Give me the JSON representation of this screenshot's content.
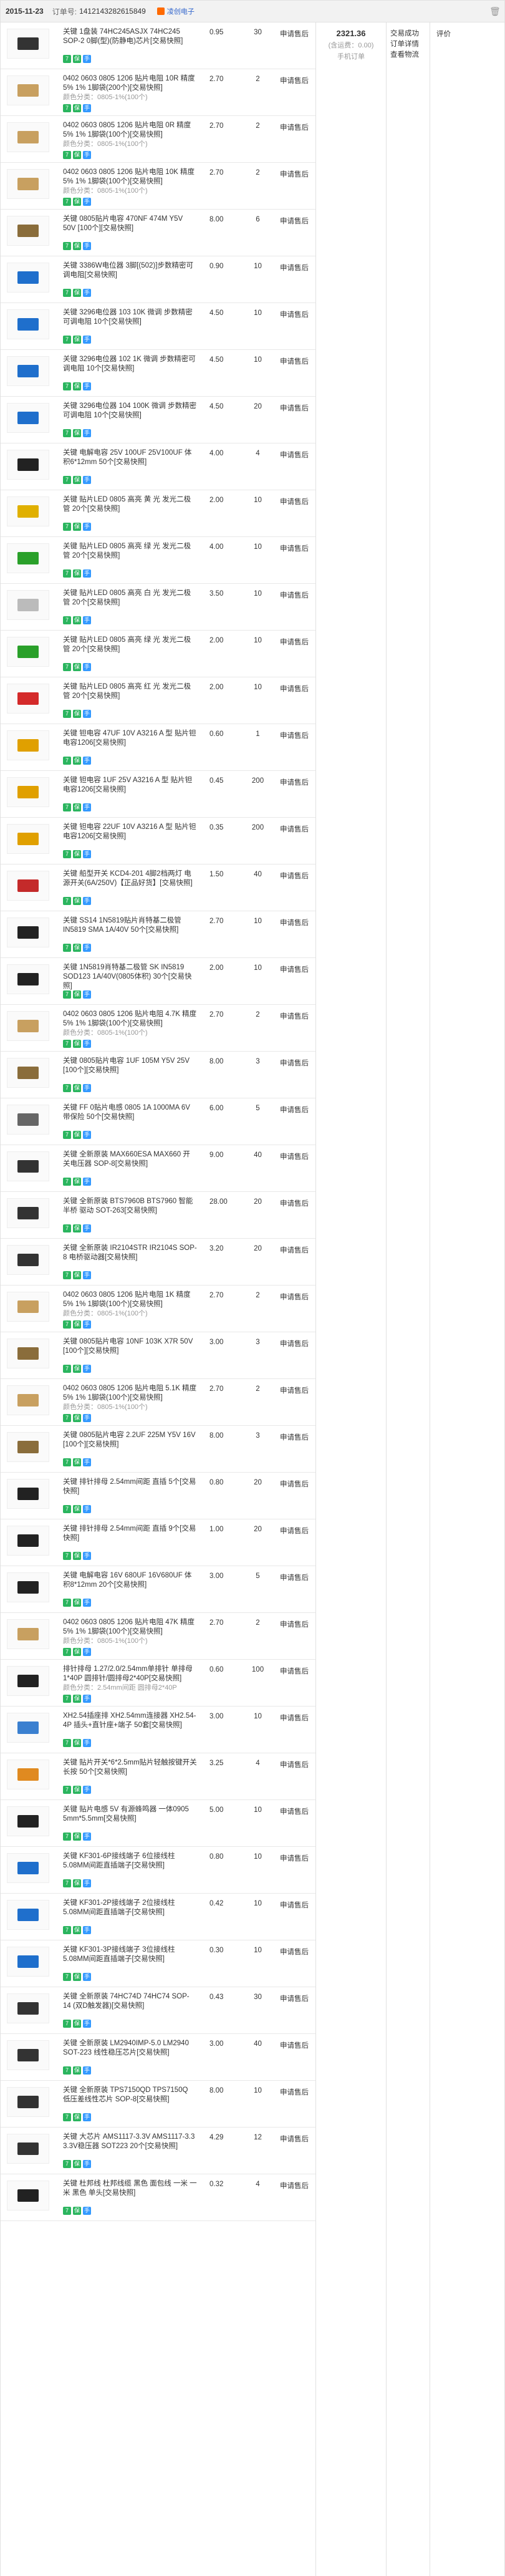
{
  "order": {
    "date": "2015-11-23",
    "order_no_label": "订单号:",
    "order_no": "1412143282615849",
    "shop_name": "凌创电子",
    "delete_icon": "trash-icon"
  },
  "summary": {
    "total": "2321.36",
    "shipping": "(含运费：0.00)",
    "payment": "手机订单"
  },
  "status": {
    "lines": [
      "交易成功",
      "订单详情",
      "查看物流"
    ]
  },
  "actions": {
    "evaluate": "评价"
  },
  "badge_icons": [
    "seven-day-return-icon",
    "guarantee-icon",
    "mobile-order-icon"
  ],
  "badge_glyphs": [
    "7",
    "保",
    "手"
  ],
  "items": [
    {
      "title": "关键 1盘装 74HC245ASJX 74HC245 SOP-2 0脚(型)(防静电)芯片[交易快照]",
      "sub": "",
      "price": "0.95",
      "qty": "30",
      "refund": "申请售后",
      "icon": "ic-chip-icon",
      "color": "#333333"
    },
    {
      "title": "0402 0603 0805 1206 贴片电阻 10R 精度5% 1% 1脚袋(200个)[交易快照]",
      "sub": "颜色分类：0805-1%(100个)",
      "price": "2.70",
      "qty": "2",
      "refund": "申请售后",
      "icon": "resistor-strip-icon",
      "color": "#c8a060"
    },
    {
      "title": "0402 0603 0805 1206 贴片电阻 0R 精度5% 1% 1脚袋(100个)[交易快照]",
      "sub": "颜色分类：0805-1%(100个)",
      "price": "2.70",
      "qty": "2",
      "refund": "申请售后",
      "icon": "resistor-strip-icon",
      "color": "#c8a060"
    },
    {
      "title": "0402 0603 0805 1206 贴片电阻 10K 精度5% 1% 1脚袋(100个)[交易快照]",
      "sub": "颜色分类：0805-1%(100个)",
      "price": "2.70",
      "qty": "2",
      "refund": "申请售后",
      "icon": "resistor-strip-icon",
      "color": "#c8a060"
    },
    {
      "title": "关键 0805贴片电容 470NF 474M Y5V 50V [100个][交易快照]",
      "sub": "",
      "price": "8.00",
      "qty": "6",
      "refund": "申请售后",
      "icon": "capacitor-icon",
      "color": "#8a6d3b"
    },
    {
      "title": "关键 3386W电位器 3脚[(502)]步数精密可调电阻[交易快照]",
      "sub": "",
      "price": "0.90",
      "qty": "10",
      "refund": "申请售后",
      "icon": "potentiometer-icon",
      "color": "#1f6fcc"
    },
    {
      "title": "关键 3296电位器 103 10K 微调 步数精密可调电阻 10个[交易快照]",
      "sub": "",
      "price": "4.50",
      "qty": "10",
      "refund": "申请售后",
      "icon": "potentiometer-icon",
      "color": "#1f6fcc"
    },
    {
      "title": "关键 3296电位器 102 1K 微调 步数精密可调电阻 10个[交易快照]",
      "sub": "",
      "price": "4.50",
      "qty": "10",
      "refund": "申请售后",
      "icon": "potentiometer-icon",
      "color": "#1f6fcc"
    },
    {
      "title": "关键 3296电位器 104 100K 微调 步数精密可调电阻 10个[交易快照]",
      "sub": "",
      "price": "4.50",
      "qty": "20",
      "refund": "申请售后",
      "icon": "potentiometer-icon",
      "color": "#1f6fcc"
    },
    {
      "title": "关键 电解电容 25V 100UF 25V100UF 体积6*12mm 50个[交易快照]",
      "sub": "",
      "price": "4.00",
      "qty": "4",
      "refund": "申请售后",
      "icon": "electrolytic-capacitor-icon",
      "color": "#222222"
    },
    {
      "title": "关键 贴片LED 0805 高亮 黄 光 发光二极管 20个[交易快照]",
      "sub": "",
      "price": "2.00",
      "qty": "10",
      "refund": "申请售后",
      "icon": "led-icon",
      "color": "#e0b000"
    },
    {
      "title": "关键 贴片LED 0805 高亮 绿 光 发光二极管 20个[交易快照]",
      "sub": "",
      "price": "4.00",
      "qty": "10",
      "refund": "申请售后",
      "icon": "led-icon",
      "color": "#2aa02a"
    },
    {
      "title": "关键 贴片LED 0805 高亮 白 光 发光二极管 20个[交易快照]",
      "sub": "",
      "price": "3.50",
      "qty": "10",
      "refund": "申请售后",
      "icon": "led-icon",
      "color": "#bbbbbb"
    },
    {
      "title": "关键 贴片LED 0805 高亮 绿 光 发光二极管 20个[交易快照]",
      "sub": "",
      "price": "2.00",
      "qty": "10",
      "refund": "申请售后",
      "icon": "led-icon",
      "color": "#2aa02a"
    },
    {
      "title": "关键 贴片LED 0805 高亮 红 光 发光二极管 20个[交易快照]",
      "sub": "",
      "price": "2.00",
      "qty": "10",
      "refund": "申请售后",
      "icon": "led-icon",
      "color": "#d42a2a"
    },
    {
      "title": "关键 钽电容 47UF 10V A3216 A 型 贴片钽电容1206[交易快照]",
      "sub": "",
      "price": "0.60",
      "qty": "1",
      "refund": "申请售后",
      "icon": "tantalum-capacitor-icon",
      "color": "#e0a000"
    },
    {
      "title": "关键 钽电容 1UF 25V A3216 A 型 贴片钽电容1206[交易快照]",
      "sub": "",
      "price": "0.45",
      "qty": "200",
      "refund": "申请售后",
      "icon": "tantalum-capacitor-icon",
      "color": "#e0a000"
    },
    {
      "title": "关键 钽电容 22UF 10V A3216 A 型 贴片钽电容1206[交易快照]",
      "sub": "",
      "price": "0.35",
      "qty": "200",
      "refund": "申请售后",
      "icon": "tantalum-capacitor-icon",
      "color": "#e0a000"
    },
    {
      "title": "关键 船型开关 KCD4-201 4脚2档两灯 电源开关(6A/250V)【正品好货】[交易快照]",
      "sub": "",
      "price": "1.50",
      "qty": "40",
      "refund": "申请售后",
      "icon": "rocker-switch-icon",
      "color": "#c42a2a"
    },
    {
      "title": "关键 SS14 1N5819贴片肖特基二极管 IN5819 SMA 1A/40V 50个[交易快照]",
      "sub": "",
      "price": "2.70",
      "qty": "10",
      "refund": "申请售后",
      "icon": "diode-icon",
      "color": "#222222"
    },
    {
      "title": "关键 1N5819肖特基二极管 SK IN5819 SOD123 1A/40V(0805体积) 30个[交易快照]",
      "sub": "",
      "price": "2.00",
      "qty": "10",
      "refund": "申请售后",
      "icon": "diode-icon",
      "color": "#222222"
    },
    {
      "title": "0402 0603 0805 1206 贴片电阻 4.7K 精度5% 1% 1脚袋(100个)[交易快照]",
      "sub": "颜色分类：0805-1%(100个)",
      "price": "2.70",
      "qty": "2",
      "refund": "申请售后",
      "icon": "resistor-strip-icon",
      "color": "#c8a060"
    },
    {
      "title": "关键 0805贴片电容 1UF 105M Y5V 25V [100个][交易快照]",
      "sub": "",
      "price": "8.00",
      "qty": "3",
      "refund": "申请售后",
      "icon": "capacitor-icon",
      "color": "#8a6d3b"
    },
    {
      "title": "关键 FF 0贴片电感 0805 1A 1000MA 6V 带保险 50个[交易快照]",
      "sub": "",
      "price": "6.00",
      "qty": "5",
      "refund": "申请售后",
      "icon": "fuse-icon",
      "color": "#666666"
    },
    {
      "title": "关键 全新原装 MAX660ESA MAX660 开关电压器 SOP-8[交易快照]",
      "sub": "",
      "price": "9.00",
      "qty": "40",
      "refund": "申请售后",
      "icon": "ic-chip-icon",
      "color": "#333333"
    },
    {
      "title": "关键 全新原装 BTS7960B BTS7960 智能半桥 驱动 SOT-263[交易快照]",
      "sub": "",
      "price": "28.00",
      "qty": "20",
      "refund": "申请售后",
      "icon": "ic-chip-icon",
      "color": "#333333"
    },
    {
      "title": "关键 全新原装 IR2104STR IR2104S SOP-8 电桥驱动器[交易快照]",
      "sub": "",
      "price": "3.20",
      "qty": "20",
      "refund": "申请售后",
      "icon": "ic-chip-icon",
      "color": "#333333"
    },
    {
      "title": "0402 0603 0805 1206 贴片电阻 1K 精度5% 1% 1脚袋(100个)[交易快照]",
      "sub": "颜色分类：0805-1%(100个)",
      "price": "2.70",
      "qty": "2",
      "refund": "申请售后",
      "icon": "resistor-strip-icon",
      "color": "#c8a060"
    },
    {
      "title": "关键 0805贴片电容 10NF 103K X7R 50V [100个][交易快照]",
      "sub": "",
      "price": "3.00",
      "qty": "3",
      "refund": "申请售后",
      "icon": "capacitor-icon",
      "color": "#8a6d3b"
    },
    {
      "title": "0402 0603 0805 1206 贴片电阻 5.1K 精度5% 1% 1脚袋(100个)[交易快照]",
      "sub": "颜色分类：0805-1%(100个)",
      "price": "2.70",
      "qty": "2",
      "refund": "申请售后",
      "icon": "resistor-strip-icon",
      "color": "#c8a060"
    },
    {
      "title": "关键 0805贴片电容 2.2UF 225M Y5V 16V [100个][交易快照]",
      "sub": "",
      "price": "8.00",
      "qty": "3",
      "refund": "申请售后",
      "icon": "capacitor-icon",
      "color": "#8a6d3b"
    },
    {
      "title": "关键 排针排母 2.54mm间距 直插 5个[交易快照]",
      "sub": "",
      "price": "0.80",
      "qty": "20",
      "refund": "申请售后",
      "icon": "pin-header-icon",
      "color": "#222222"
    },
    {
      "title": "关键 排针排母 2.54mm间距 直插 9个[交易快照]",
      "sub": "",
      "price": "1.00",
      "qty": "20",
      "refund": "申请售后",
      "icon": "pin-header-icon",
      "color": "#222222"
    },
    {
      "title": "关键 电解电容 16V 680UF 16V680UF 体积8*12mm 20个[交易快照]",
      "sub": "",
      "price": "3.00",
      "qty": "5",
      "refund": "申请售后",
      "icon": "electrolytic-capacitor-icon",
      "color": "#222222"
    },
    {
      "title": "0402 0603 0805 1206 贴片电阻 47K 精度5% 1% 1脚袋(100个)[交易快照]",
      "sub": "颜色分类：0805-1%(100个)",
      "price": "2.70",
      "qty": "2",
      "refund": "申请售后",
      "icon": "resistor-strip-icon",
      "color": "#c8a060"
    },
    {
      "title": "排针排母 1.27/2.0/2.54mm单排针 单排母1*40P 圆排针/圆排母2*40P[交易快照]",
      "sub": "颜色分类：2.54mm间距 圆排母2*40P",
      "price": "0.60",
      "qty": "100",
      "refund": "申请售后",
      "icon": "pin-header-icon",
      "color": "#222222"
    },
    {
      "title": "XH2.54插座排 XH2.54mm连接器 XH2.54-4P 插头+直针座+端子 50套[交易快照]",
      "sub": "",
      "price": "3.00",
      "qty": "10",
      "refund": "申请售后",
      "icon": "connector-icon",
      "color": "#3a80d0"
    },
    {
      "title": "关键 贴片开关*6*2.5mm贴片轻触按键开关 长按 50个[交易快照]",
      "sub": "",
      "price": "3.25",
      "qty": "4",
      "refund": "申请售后",
      "icon": "tactile-switch-icon",
      "color": "#e08a20"
    },
    {
      "title": "关键 贴片电感 5V 有源蜂鸣器 一体0905 5mm*5.5mm[交易快照]",
      "sub": "",
      "price": "5.00",
      "qty": "10",
      "refund": "申请售后",
      "icon": "buzzer-icon",
      "color": "#222222"
    },
    {
      "title": "关键 KF301-6P接线端子 6位接线柱 5.08MM间距直插端子[交易快照]",
      "sub": "",
      "price": "0.80",
      "qty": "10",
      "refund": "申请售后",
      "icon": "terminal-block-icon",
      "color": "#1f6fcc"
    },
    {
      "title": "关键 KF301-2P接线端子 2位接线柱 5.08MM间距直插端子[交易快照]",
      "sub": "",
      "price": "0.42",
      "qty": "10",
      "refund": "申请售后",
      "icon": "terminal-block-icon",
      "color": "#1f6fcc"
    },
    {
      "title": "关键 KF301-3P接线端子 3位接线柱 5.08MM间距直插端子[交易快照]",
      "sub": "",
      "price": "0.30",
      "qty": "10",
      "refund": "申请售后",
      "icon": "terminal-block-icon",
      "color": "#1f6fcc"
    },
    {
      "title": "关键 全新原装 74HC74D 74HC74 SOP-14 (双D触发器)[交易快照]",
      "sub": "",
      "price": "0.43",
      "qty": "30",
      "refund": "申请售后",
      "icon": "ic-chip-icon",
      "color": "#333333"
    },
    {
      "title": "关键 全新原装 LM2940IMP-5.0 LM2940 SOT-223 线性稳压芯片[交易快照]",
      "sub": "",
      "price": "3.00",
      "qty": "40",
      "refund": "申请售后",
      "icon": "ic-chip-icon",
      "color": "#333333"
    },
    {
      "title": "关键 全新原装 TPS7150QD TPS7150Q 低压差线性芯片 SOP-8[交易快照]",
      "sub": "",
      "price": "8.00",
      "qty": "10",
      "refund": "申请售后",
      "icon": "ic-chip-icon",
      "color": "#333333"
    },
    {
      "title": "关键 大芯片 AMS1117-3.3V AMS1117-3.3 3.3V稳压器 SOT223 20个[交易快照]",
      "sub": "",
      "price": "4.29",
      "qty": "12",
      "refund": "申请售后",
      "icon": "ic-chip-icon",
      "color": "#333333"
    },
    {
      "title": "关键 杜邦线 杜邦线缆 黑色 面包线 一米 一米 黑色 单头[交易快照]",
      "sub": "",
      "price": "0.32",
      "qty": "4",
      "refund": "申请售后",
      "icon": "jumper-wire-icon",
      "color": "#222222"
    }
  ]
}
